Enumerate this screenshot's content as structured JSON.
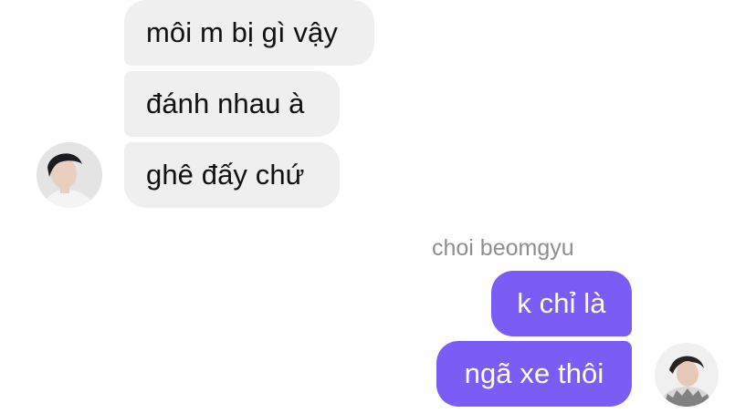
{
  "incoming": {
    "messages": [
      "môi m bị gì vậy",
      "đánh nhau à",
      "ghê đấy chứ"
    ]
  },
  "outgoing": {
    "sender_name": "choi beomgyu",
    "messages": [
      "k chỉ là",
      "ngã xe thôi"
    ]
  },
  "colors": {
    "incoming_bubble": "#efefef",
    "outgoing_bubble": "#7b5cf5",
    "sender_name": "#8e8e8e"
  },
  "icons": {
    "left_avatar": "contact-avatar-photo",
    "right_avatar": "user-avatar-photo"
  }
}
